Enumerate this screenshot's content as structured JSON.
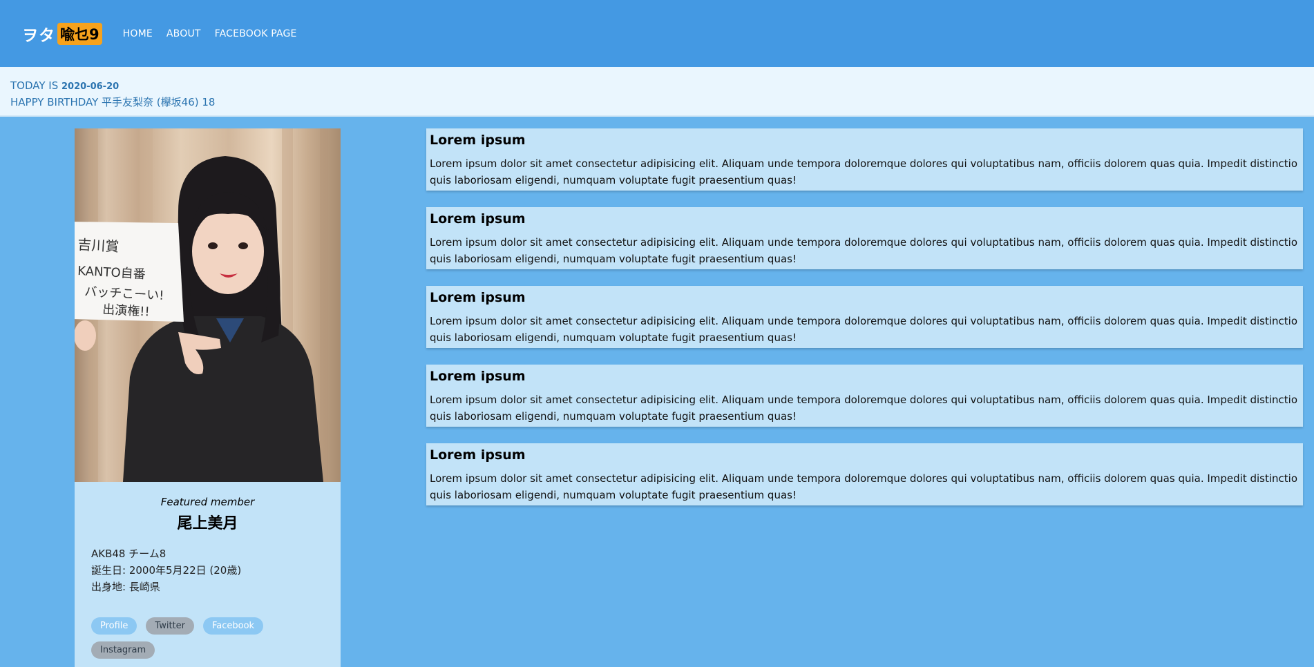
{
  "header": {
    "logo_part1": "ヲタ",
    "logo_part2": "喩乜9",
    "nav": [
      {
        "label": "HOME"
      },
      {
        "label": "ABOUT"
      },
      {
        "label": "FACEBOOK PAGE"
      }
    ]
  },
  "infobar": {
    "today_prefix": "TODAY IS",
    "date": "2020-06-20",
    "birthday_line": "HAPPY BIRTHDAY 平手友梨奈 (欅坂46) 18"
  },
  "featured": {
    "label": "Featured member",
    "name": "尾上美月",
    "team": "AKB48 チーム8",
    "birthday": "誕生日: 2000年5月22日 (20歳)",
    "hometown": "出身地: 長崎県",
    "links": [
      {
        "label": "Profile",
        "style": "primary"
      },
      {
        "label": "Twitter",
        "style": "secondary"
      },
      {
        "label": "Facebook",
        "style": "primary"
      },
      {
        "label": "Instagram",
        "style": "secondary"
      }
    ]
  },
  "posts": [
    {
      "title": "Lorem ipsum",
      "body": "Lorem ipsum dolor sit amet consectetur adipisicing elit. Aliquam unde tempora doloremque dolores qui voluptatibus nam, officiis dolorem quas quia. Impedit distinctio quis laboriosam eligendi, numquam voluptate fugit praesentium quas!"
    },
    {
      "title": "Lorem ipsum",
      "body": "Lorem ipsum dolor sit amet consectetur adipisicing elit. Aliquam unde tempora doloremque dolores qui voluptatibus nam, officiis dolorem quas quia. Impedit distinctio quis laboriosam eligendi, numquam voluptate fugit praesentium quas!"
    },
    {
      "title": "Lorem ipsum",
      "body": "Lorem ipsum dolor sit amet consectetur adipisicing elit. Aliquam unde tempora doloremque dolores qui voluptatibus nam, officiis dolorem quas quia. Impedit distinctio quis laboriosam eligendi, numquam voluptate fugit praesentium quas!"
    },
    {
      "title": "Lorem ipsum",
      "body": "Lorem ipsum dolor sit amet consectetur adipisicing elit. Aliquam unde tempora doloremque dolores qui voluptatibus nam, officiis dolorem quas quia. Impedit distinctio quis laboriosam eligendi, numquam voluptate fugit praesentium quas!"
    },
    {
      "title": "Lorem ipsum",
      "body": "Lorem ipsum dolor sit amet consectetur adipisicing elit. Aliquam unde tempora doloremque dolores qui voluptatibus nam, officiis dolorem quas quia. Impedit distinctio quis laboriosam eligendi, numquam voluptate fugit praesentium quas!"
    }
  ],
  "colors": {
    "header_bg": "#4499e3",
    "page_bg": "#66b3ec",
    "infobar_bg": "#eaf6fe",
    "card_bg": "#c2e3f8",
    "logo_badge": "#f7a21c"
  }
}
